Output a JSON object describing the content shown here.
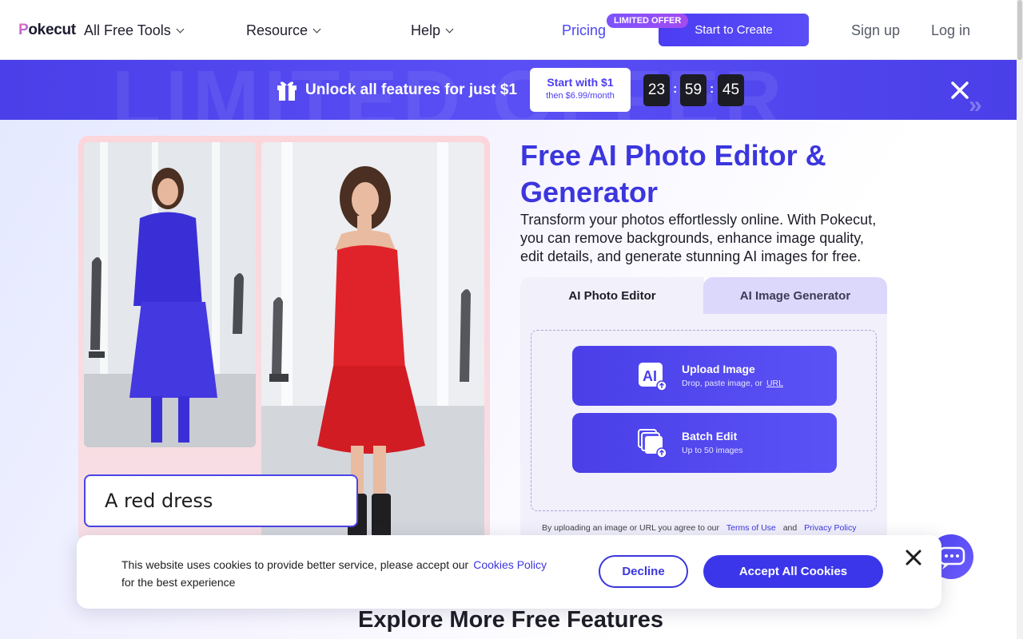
{
  "nav": {
    "logo": "Pokecut",
    "items": [
      {
        "label": "All Free Tools"
      },
      {
        "label": "Resource"
      },
      {
        "label": "Help"
      }
    ],
    "pricing": "Pricing",
    "limited_badge": "LIMITED OFFER",
    "start_button": "Start to Create",
    "signup": "Sign up",
    "login": "Log in"
  },
  "banner": {
    "watermark": "LIMITED OFFER",
    "text": "Unlock all features for just $1",
    "cta_main": "Start with $1",
    "cta_sub": "then $6.99/month",
    "timer": {
      "hours": "23",
      "minutes": "59",
      "seconds": "45"
    }
  },
  "hero": {
    "title": "Free AI Photo Editor & Generator",
    "description": "Transform your photos effortlessly online. With Pokecut, you can remove backgrounds, enhance image quality, edit details, and generate stunning AI images for free.",
    "prompt_text": "A red dress",
    "tabs": [
      {
        "label": "AI Photo Editor",
        "active": true
      },
      {
        "label": "AI Image Generator",
        "active": false
      }
    ],
    "upload": {
      "title": "Upload Image",
      "sub": "Drop, paste image, or",
      "link": "URL"
    },
    "batch": {
      "title": "Batch Edit",
      "sub": "Up to 50 images"
    },
    "terms": {
      "prefix": "By uploading an image or URL you agree to our",
      "terms_link": "Terms of Use",
      "and": "and",
      "privacy_link": "Privacy Policy"
    }
  },
  "cookie": {
    "text": "This website uses cookies to provide better service, please accept our",
    "link": "Cookies Policy",
    "text2": "for the best experience",
    "decline": "Decline",
    "accept": "Accept All Cookies"
  },
  "explore": "Explore More Free Features",
  "colors": {
    "brand": "#4b3df2",
    "accent_text": "#3b36dd",
    "dress": "#e0232a",
    "jacket": "#3a2fd6"
  }
}
